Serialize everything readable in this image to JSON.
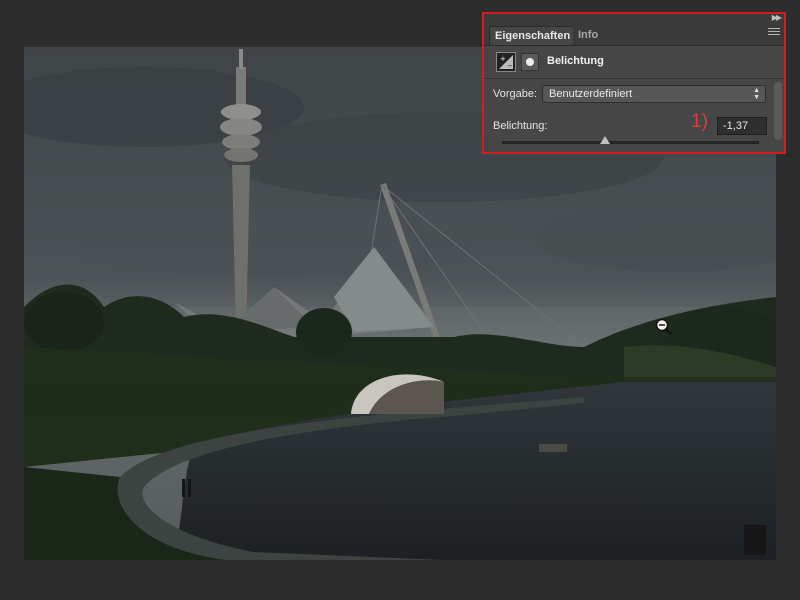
{
  "panel": {
    "tabs": [
      {
        "label": "Eigenschaften",
        "active": true
      },
      {
        "label": "Info",
        "active": false
      }
    ],
    "adjustment_title": "Belichtung",
    "preset": {
      "label": "Vorgabe:",
      "value": "Benutzerdefiniert"
    },
    "exposure": {
      "label": "Belichtung:",
      "value": "-1,37",
      "slider_fraction": 0.4
    },
    "annotation": "1)",
    "highlight_color": "#d01e1e"
  },
  "icons": {
    "panel_collapse": "double-chevron-right-icon",
    "panel_menu": "panel-menu-icon",
    "adjustment_layer": "exposure-adjustment-icon",
    "layer_mask": "layer-mask-icon",
    "cursor": "zoom-out-icon"
  }
}
